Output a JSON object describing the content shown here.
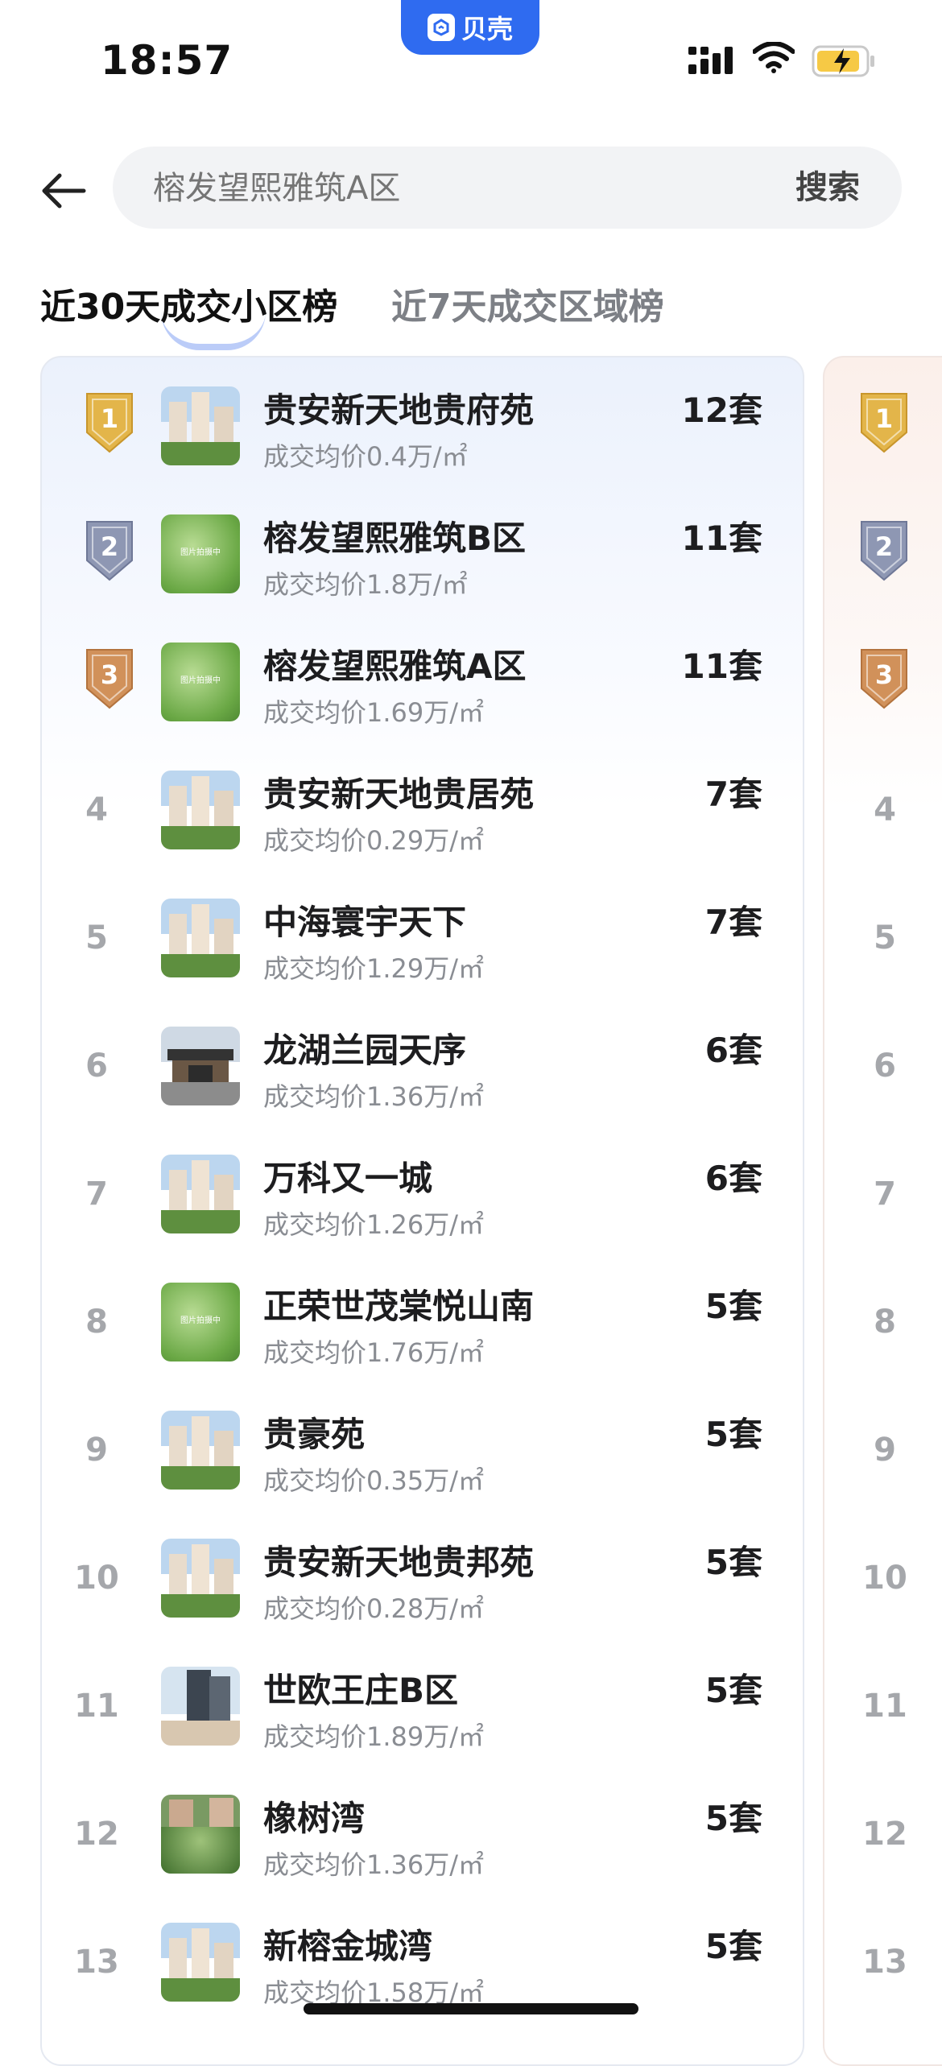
{
  "status_bar": {
    "time": "18:57",
    "app_name": "贝壳",
    "battery_color": "#f6c945"
  },
  "search": {
    "placeholder": "榕发望熙雅筑A区",
    "button_label": "搜索"
  },
  "tabs": [
    {
      "label": "近30天成交小区榜",
      "active": true
    },
    {
      "label": "近7天成交区域榜",
      "active": false
    }
  ],
  "colors": {
    "accent": "#2f6bf0",
    "gold": "#e3b54a",
    "silver": "#8e97b3",
    "bronze": "#d1915a"
  },
  "ranking": [
    {
      "rank": "1",
      "name": "贵安新天地贵府苑",
      "price": "成交均价0.4万/㎡",
      "count": "12套",
      "thumb": "buildings"
    },
    {
      "rank": "2",
      "name": "榕发望熙雅筑B区",
      "price": "成交均价1.8万/㎡",
      "count": "11套",
      "thumb": "placeholder"
    },
    {
      "rank": "3",
      "name": "榕发望熙雅筑A区",
      "price": "成交均价1.69万/㎡",
      "count": "11套",
      "thumb": "placeholder"
    },
    {
      "rank": "4",
      "name": "贵安新天地贵居苑",
      "price": "成交均价0.29万/㎡",
      "count": "7套",
      "thumb": "buildings"
    },
    {
      "rank": "5",
      "name": "中海寰宇天下",
      "price": "成交均价1.29万/㎡",
      "count": "7套",
      "thumb": "buildings"
    },
    {
      "rank": "6",
      "name": "龙湖兰园天序",
      "price": "成交均价1.36万/㎡",
      "count": "6套",
      "thumb": "gate"
    },
    {
      "rank": "7",
      "name": "万科又一城",
      "price": "成交均价1.26万/㎡",
      "count": "6套",
      "thumb": "buildings"
    },
    {
      "rank": "8",
      "name": "正荣世茂棠悦山南",
      "price": "成交均价1.76万/㎡",
      "count": "5套",
      "thumb": "placeholder"
    },
    {
      "rank": "9",
      "name": "贵豪苑",
      "price": "成交均价0.35万/㎡",
      "count": "5套",
      "thumb": "buildings"
    },
    {
      "rank": "10",
      "name": "贵安新天地贵邦苑",
      "price": "成交均价0.28万/㎡",
      "count": "5套",
      "thumb": "buildings"
    },
    {
      "rank": "11",
      "name": "世欧王庄B区",
      "price": "成交均价1.89万/㎡",
      "count": "5套",
      "thumb": "tower"
    },
    {
      "rank": "12",
      "name": "橡树湾",
      "price": "成交均价1.36万/㎡",
      "count": "5套",
      "thumb": "garden"
    },
    {
      "rank": "13",
      "name": "新榕金城湾",
      "price": "成交均价1.58万/㎡",
      "count": "5套",
      "thumb": "buildings"
    }
  ],
  "placeholder_thumb_text": "图片拍摄中",
  "second_card_ranks": [
    "1",
    "2",
    "3",
    "4",
    "5",
    "6",
    "7",
    "8",
    "9",
    "10",
    "11",
    "12",
    "13"
  ]
}
